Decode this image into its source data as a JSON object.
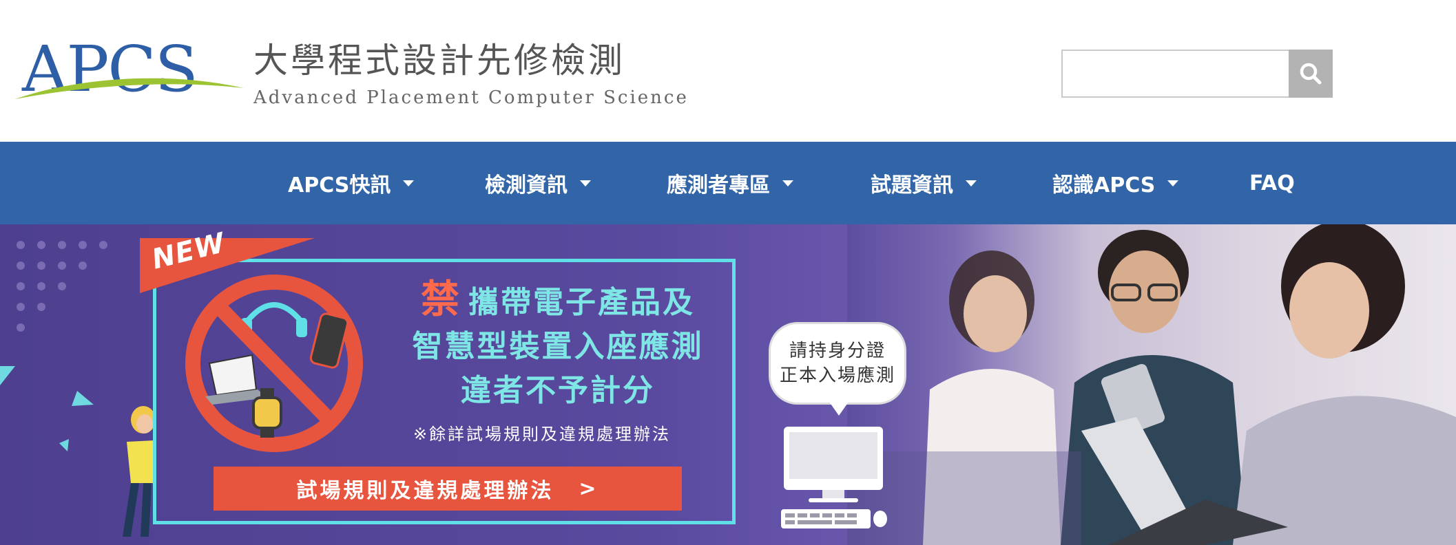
{
  "brand": {
    "logo_text": "APCS",
    "title_zh": "大學程式設計先修檢測",
    "title_en": "Advanced Placement Computer Science"
  },
  "search": {
    "placeholder": "",
    "value": ""
  },
  "nav": {
    "items": [
      {
        "label": "APCS快訊",
        "has_dropdown": true
      },
      {
        "label": "檢測資訊",
        "has_dropdown": true
      },
      {
        "label": "應測者專區",
        "has_dropdown": true
      },
      {
        "label": "試題資訊",
        "has_dropdown": true
      },
      {
        "label": "認識APCS",
        "has_dropdown": true
      },
      {
        "label": "FAQ",
        "has_dropdown": false
      }
    ]
  },
  "banner": {
    "tag": "NEW",
    "ban_char": "禁",
    "headline_line1": "攜帶電子產品及",
    "headline_line2": "智慧型裝置入座應測",
    "headline_line3": "違者不予計分",
    "note": "※餘詳試場規則及違規處理辦法",
    "button_label": "試場規則及違規處理辦法",
    "button_arrow": ">",
    "bubble_line1": "請持身分證",
    "bubble_line2": "正本入場應測"
  },
  "colors": {
    "nav_bg": "#3165a7",
    "logo_blue": "#2e5fa6",
    "logo_green": "#9cc332",
    "banner_bg": "#4e3f8f",
    "accent_red": "#e8553f",
    "accent_cyan": "#5ee0e6"
  },
  "icons": {
    "search_button": "search-icon",
    "dropdown": "caret-down-icon",
    "prohibited": "no-devices-icon",
    "computer": "desktop-computer-icon"
  }
}
